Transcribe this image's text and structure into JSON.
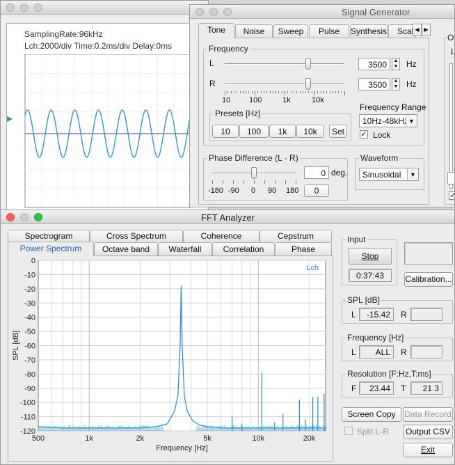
{
  "oscilloscope": {
    "sampling_rate": "SamplingRate:96kHz",
    "scale_info": "Lch:2000/div  Time:0.2ms/div  Delay:0ms"
  },
  "signal_generator": {
    "title": "Signal Generator",
    "tabs": [
      "Tone",
      "Noise",
      "Sweep",
      "Pulse",
      "Synthesis",
      "Scal"
    ],
    "frequency": {
      "label": "Frequency",
      "channel_l": "L",
      "channel_r": "R",
      "value_l": "3500",
      "value_r": "3500",
      "unit": "Hz",
      "scale_labels": [
        "10",
        "100",
        "1k",
        "10k"
      ]
    },
    "presets": {
      "label": "Presets [Hz]",
      "buttons": [
        "10",
        "100",
        "1k",
        "10k"
      ],
      "set_label": "Set"
    },
    "frequency_range": {
      "label": "Frequency Range",
      "value": "10Hz-48kHz",
      "lock_label": "Lock",
      "lock_checked": true
    },
    "phase": {
      "label": "Phase Difference (L - R)",
      "value": "0",
      "unit": "deg.",
      "reset_label": "0",
      "scale_labels": [
        "-180",
        "-90",
        "0",
        "90",
        "180"
      ]
    },
    "waveform": {
      "label": "Waveform",
      "value": "Sinusoidal"
    },
    "partial_label_1": "Ou",
    "partial_label_2": "L"
  },
  "fft_analyzer": {
    "title": "FFT Analyzer",
    "tabs_top": [
      "Spectrogram",
      "Cross Spectrum",
      "Coherence",
      "Cepstrum"
    ],
    "tabs_bottom": [
      "Power Spectrum",
      "Octave band",
      "Waterfall",
      "Correlation",
      "Phase"
    ],
    "input": {
      "label": "Input",
      "stop_label": "Stop",
      "elapsed": "0:37:43"
    },
    "calibration_label": "Calibration...",
    "spl": {
      "label": "SPL [dB]",
      "l_label": "L",
      "l_value": "-15.42",
      "r_label": "R",
      "r_value": ""
    },
    "frequency": {
      "label": "Frequency [Hz]",
      "l_label": "L",
      "l_value": "ALL",
      "r_label": "R",
      "r_value": ""
    },
    "resolution": {
      "label": "Resolution [F:Hz,T:ms]",
      "f_label": "F",
      "f_value": "23.44",
      "t_label": "T",
      "t_value": "21.3"
    },
    "screen_copy_label": "Screen Copy",
    "data_record_label": "Data Record",
    "split_lr_label": "Split L-R",
    "output_csv_label": "Output CSV",
    "exit_label": "Exit"
  },
  "chart_data": {
    "type": "line",
    "xlabel": "Frequency [Hz]",
    "ylabel": "SPL [dB]",
    "x_scale": "log",
    "xlim": [
      500,
      25000
    ],
    "ylim": [
      -120,
      0
    ],
    "x_tick_labels": [
      "500",
      "1k",
      "2k",
      "5k",
      "10k",
      "20k"
    ],
    "x_tick_values": [
      500,
      1000,
      2000,
      5000,
      10000,
      20000
    ],
    "y_ticks": [
      0,
      -10,
      -20,
      -30,
      -40,
      -50,
      -60,
      -70,
      -80,
      -90,
      -100,
      -110,
      -120
    ],
    "grid": true,
    "legend": "top-right",
    "series": [
      {
        "name": "Lch",
        "color": "#1a8fd0",
        "peak": {
          "x": 3500,
          "y": -18
        },
        "x": [
          500,
          700,
          1000,
          1500,
          2000,
          2500,
          2900,
          3200,
          3350,
          3450,
          3500,
          3550,
          3650,
          3800,
          4100,
          4500,
          5000,
          6000,
          7000,
          7500,
          8000,
          10000,
          10500,
          12000,
          14000,
          15000,
          17500,
          20000,
          22000,
          24000
        ],
        "y": [
          -117,
          -118,
          -118,
          -118,
          -118,
          -117,
          -115,
          -106,
          -95,
          -60,
          -18,
          -60,
          -95,
          -106,
          -113,
          -116,
          -117,
          -118,
          -118,
          -118,
          -118,
          -118,
          -118,
          -118,
          -118,
          -118,
          -118,
          -118,
          -118,
          -118
        ]
      }
    ],
    "harmonic_spikes": [
      {
        "x": 7000,
        "y": -110
      },
      {
        "x": 10500,
        "y": -79
      },
      {
        "x": 14000,
        "y": -108
      },
      {
        "x": 17500,
        "y": -98
      },
      {
        "x": 21000,
        "y": -96
      },
      {
        "x": 22500,
        "y": -96
      },
      {
        "x": 24500,
        "y": -94
      },
      {
        "x": 8000,
        "y": -115
      },
      {
        "x": 12500,
        "y": -114
      },
      {
        "x": 19000,
        "y": -112
      }
    ]
  }
}
